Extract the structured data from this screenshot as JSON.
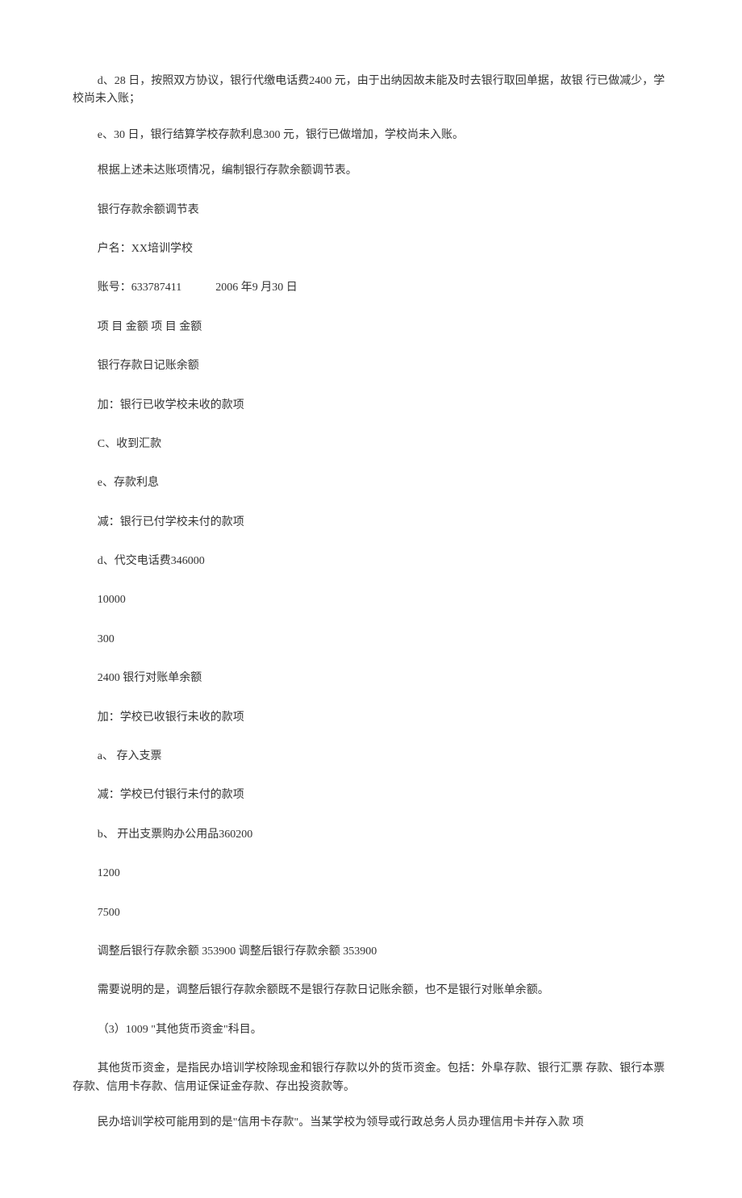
{
  "paragraphs": {
    "p1": "d、28 日，按照双方协议，银行代缴电话费2400 元，由于出纳因故未能及时去银行取回单据，故银 行已做减少，学校尚未入账；",
    "p2": "e、30 日，银行结算学校存款利息300 元，银行已做增加，学校尚未入账。",
    "p3": "根据上述未达账项情况，编制银行存款余额调节表。",
    "p4": "银行存款余额调节表",
    "p5": "户名：XX培训学校",
    "p6a": "账号：633787411",
    "p6b": "2006 年9 月30 日",
    "p7": "项 目 金额 项 目 金额",
    "p8": "银行存款日记账余额",
    "p9": "加：银行已收学校未收的款项",
    "p10": "C、收到汇款",
    "p11": "e、存款利息",
    "p12": "减：银行已付学校未付的款项",
    "p13": "d、代交电话费346000",
    "p14": "10000",
    "p15": "300",
    "p16": "2400 银行对账单余额",
    "p17": "加：学校已收银行未收的款项",
    "p18": "a、 存入支票",
    "p19": "减：学校已付银行未付的款项",
    "p20": "b、 开出支票购办公用品360200",
    "p21": "1200",
    "p22": "7500",
    "p23": "调整后银行存款余额 353900 调整后银行存款余额 353900",
    "p24": "需要说明的是，调整后银行存款余额既不是银行存款日记账余额，也不是银行对账单余额。",
    "p25": "（3）1009 \"其他货币资金\"科目。",
    "p26": "其他货币资金，是指民办培训学校除现金和银行存款以外的货币资金。包括：外阜存款、银行汇票 存款、银行本票存款、信用卡存款、信用证保证金存款、存出投资款等。",
    "p27": "民办培训学校可能用到的是\"信用卡存款\"。当某学校为领导或行政总务人员办理信用卡并存入款 项"
  }
}
